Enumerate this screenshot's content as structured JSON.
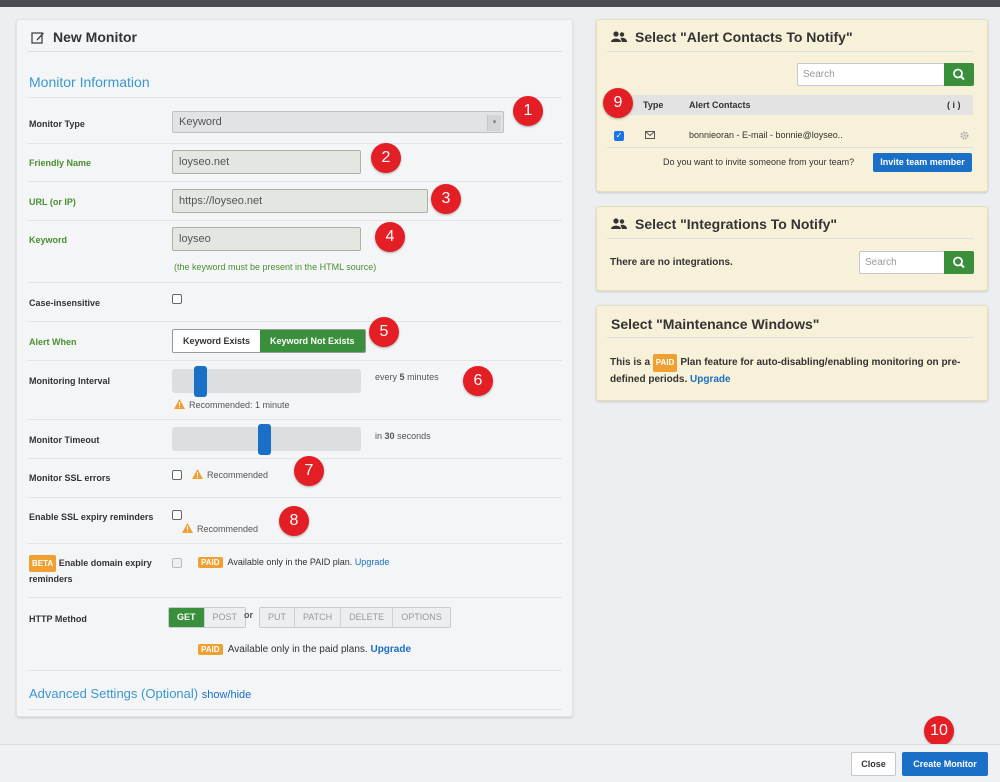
{
  "left": {
    "title": "New Monitor",
    "section_title": "Monitor Information",
    "monitor_type": {
      "label": "Monitor Type",
      "value": "Keyword"
    },
    "friendly_name": {
      "label": "Friendly Name",
      "value": "loyseo.net"
    },
    "url": {
      "label": "URL (or IP)",
      "value": "https://loyseo.net"
    },
    "keyword": {
      "label": "Keyword",
      "value": "loyseo",
      "hint": "(the keyword must be present in the HTML source)"
    },
    "case_insensitive": {
      "label": "Case-insensitive"
    },
    "alert_when": {
      "label": "Alert When",
      "option_exists": "Keyword Exists",
      "option_not_exists": "Keyword Not Exists",
      "selected": "Keyword Not Exists"
    },
    "interval": {
      "label": "Monitoring Interval",
      "text_prefix": "every",
      "value": "5",
      "text_suffix": "minutes",
      "recommended": "Recommended: 1 minute",
      "level": 0.05
    },
    "timeout": {
      "label": "Monitor Timeout",
      "text_prefix": "in",
      "value": "30",
      "text_suffix": "seconds",
      "level": 0.5
    },
    "ssl_errors": {
      "label": "Monitor SSL errors",
      "recommended": "Recommended"
    },
    "ssl_expiry": {
      "label": "Enable SSL expiry reminders",
      "recommended": "Recommended"
    },
    "domain_expiry": {
      "beta": "BETA",
      "label": "Enable domain expiry",
      "label2": "reminders",
      "paid": "PAID",
      "text": "Available only in the PAID plan.",
      "upgrade": "Upgrade"
    },
    "http_method": {
      "label": "HTTP Method",
      "methods_a": [
        "GET",
        "POST"
      ],
      "or": "or",
      "methods_b": [
        "PUT",
        "PATCH",
        "DELETE",
        "OPTIONS"
      ],
      "paid": "PAID",
      "text": "Available only in the paid plans.",
      "upgrade": "Upgrade"
    },
    "advanced": {
      "title": "Advanced Settings (Optional)",
      "toggle": "show/hide"
    }
  },
  "alert_contacts": {
    "title": "Select \"Alert Contacts To Notify\"",
    "search_placeholder": "Search",
    "col_type": "Type",
    "col_contacts": "Alert Contacts",
    "col_info": "( i )",
    "row": "bonnieoran - E-mail - bonnie@loyseo..",
    "invite_text": "Do you want to invite someone from your team?",
    "invite_button": "Invite team member"
  },
  "integrations": {
    "title": "Select \"Integrations To Notify\"",
    "empty_text": "There are no integrations.",
    "search_placeholder": "Search"
  },
  "maintenance": {
    "title": "Select \"Maintenance Windows\"",
    "text_a": "This is a",
    "paid": "PAID",
    "text_b": "Plan feature for auto-disabling/enabling monitoring on pre-defined periods.",
    "upgrade": "Upgrade"
  },
  "footer": {
    "close": "Close",
    "create": "Create Monitor"
  },
  "badges": [
    "1",
    "2",
    "3",
    "4",
    "5",
    "6",
    "7",
    "8",
    "9",
    "10"
  ],
  "colors": {
    "accent_green": "#3a8f3a",
    "accent_blue": "#1a6fc7",
    "badge_red": "#e31e24",
    "paid_orange": "#f0a030",
    "section_blue": "#3c97cf"
  }
}
